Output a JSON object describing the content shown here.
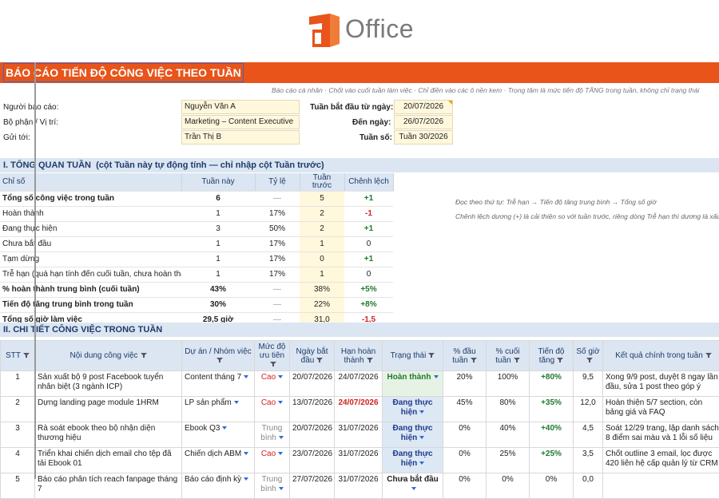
{
  "logo": {
    "text": "Office"
  },
  "title": "BÁO CÁO TIẾN ĐỘ CÔNG VIỆC THEO TUẦN",
  "note": "Báo cáo cá nhân · Chốt vào cuối tuần làm việc · Chỉ điền vào các ô nền kem · Trọng tâm là mức tiến độ TĂNG trong tuần, không chỉ trạng thái",
  "info": {
    "reporter_label": "Người báo cáo:",
    "reporter": "Nguyễn Văn A",
    "dept_label": "Bộ phận / Vị trí:",
    "dept": "Marketing – Content Executive",
    "sendto_label": "Gửi tới:",
    "sendto": "Trần Thị B",
    "start_label": "Tuần bắt đầu từ ngày:",
    "start": "20/07/2026",
    "end_label": "Đến ngày:",
    "end": "26/07/2026",
    "week_label": "Tuần số:",
    "week": "Tuần 30/2026"
  },
  "section1": {
    "title": "I. TỔNG QUAN TUẦN",
    "subtitle": "(cột Tuần này tự động tính — chỉ nhập cột Tuần trước)"
  },
  "overview": {
    "headers": [
      "Chỉ số",
      "Tuần này",
      "Tỷ lệ",
      "Tuần trước",
      "Chênh lệch"
    ],
    "rows": [
      {
        "label": "Tổng số công việc trong tuần",
        "now": "6",
        "rate": "—",
        "prev": "5",
        "diff": "+1"
      },
      {
        "label": "Hoàn thành",
        "now": "1",
        "rate": "17%",
        "prev": "2",
        "diff": "-1"
      },
      {
        "label": "Đang thực hiện",
        "now": "3",
        "rate": "50%",
        "prev": "2",
        "diff": "+1"
      },
      {
        "label": "Chưa bắt đầu",
        "now": "1",
        "rate": "17%",
        "prev": "1",
        "diff": "0"
      },
      {
        "label": "Tạm dừng",
        "now": "1",
        "rate": "17%",
        "prev": "0",
        "diff": "+1"
      },
      {
        "label": "Trễ hạn (quá hạn tính đến cuối tuần, chưa hoàn thành)",
        "now": "1",
        "rate": "17%",
        "prev": "1",
        "diff": "0"
      },
      {
        "label": "% hoàn thành trung bình (cuối tuần)",
        "now": "43%",
        "rate": "—",
        "prev": "38%",
        "diff": "+5%"
      },
      {
        "label": "Tiến độ tăng trung bình trong tuần",
        "now": "30%",
        "rate": "—",
        "prev": "22%",
        "diff": "+8%"
      },
      {
        "label": "Tổng số giờ làm việc",
        "now": "29,5 giờ",
        "rate": "—",
        "prev": "31,0",
        "diff": "-1,5"
      }
    ]
  },
  "side_notes": [
    "Đọc theo thứ tự: Trễ hạn → Tiến độ tăng trung bình → Tổng số giờ",
    "Chênh lệch dương (+) là cải thiện so với tuần trước, riêng dòng Trễ hạn thì dương là xấu"
  ],
  "section2": {
    "title": "II. CHI TIẾT CÔNG VIỆC TRONG TUẦN"
  },
  "details": {
    "headers": [
      "STT",
      "Nội dung công việc",
      "Dự án / Nhóm việc",
      "Mức độ ưu tiên",
      "Ngày bắt đầu",
      "Hạn hoàn thành",
      "Trạng thái",
      "% đầu tuần",
      "% cuối tuần",
      "Tiến độ tăng",
      "Số giờ",
      "Kết quả chính trong tuần"
    ],
    "rows": [
      {
        "stt": "1",
        "task": "Sản xuất bộ 9 post Facebook tuyển nhân biệt (3 ngành ICP)",
        "project": "Content tháng 7",
        "priority": "Cao",
        "start": "20/07/2026",
        "due": "24/07/2026",
        "status": "Hoàn thành",
        "p0": "20%",
        "p1": "100%",
        "inc": "+80%",
        "hours": "9,5",
        "result": "Xong 9/9 post, duyệt 8 ngay lần đầu, sửa 1 post theo góp ý"
      },
      {
        "stt": "2",
        "task": "Dựng landing page module 1HRM",
        "project": "LP sản phẩm",
        "priority": "Cao",
        "start": "13/07/2026",
        "due": "24/07/2026",
        "status": "Đang thực hiện",
        "p0": "45%",
        "p1": "80%",
        "inc": "+35%",
        "hours": "12,0",
        "result": "Hoàn thiện 5/7 section, còn bảng giá và FAQ"
      },
      {
        "stt": "3",
        "task": "Rà soát ebook theo bộ nhận diện thương hiệu",
        "project": "Ebook Q3",
        "priority": "Trung bình",
        "start": "20/07/2026",
        "due": "31/07/2026",
        "status": "Đang thực hiện",
        "p0": "0%",
        "p1": "40%",
        "inc": "+40%",
        "hours": "4,5",
        "result": "Soát 12/29 trang, lập danh sách 8 điểm sai màu và 1 lỗi số liệu"
      },
      {
        "stt": "4",
        "task": "Triển khai chiến dịch email cho tệp đã tải Ebook 01",
        "project": "Chiến dịch ABM",
        "priority": "Cao",
        "start": "23/07/2026",
        "due": "31/07/2026",
        "status": "Đang thực hiện",
        "p0": "0%",
        "p1": "25%",
        "inc": "+25%",
        "hours": "3,5",
        "result": "Chốt outline 3 email, lọc được 420 liên hệ cấp quản lý từ CRM"
      },
      {
        "stt": "5",
        "task": "Báo cáo phân tích reach fanpage tháng 7",
        "project": "Báo cáo định kỳ",
        "priority": "Trung bình",
        "start": "27/07/2026",
        "due": "31/07/2026",
        "status": "Chưa bắt đầu",
        "p0": "0%",
        "p1": "0%",
        "inc": "0%",
        "hours": "0,0",
        "result": ""
      }
    ]
  }
}
